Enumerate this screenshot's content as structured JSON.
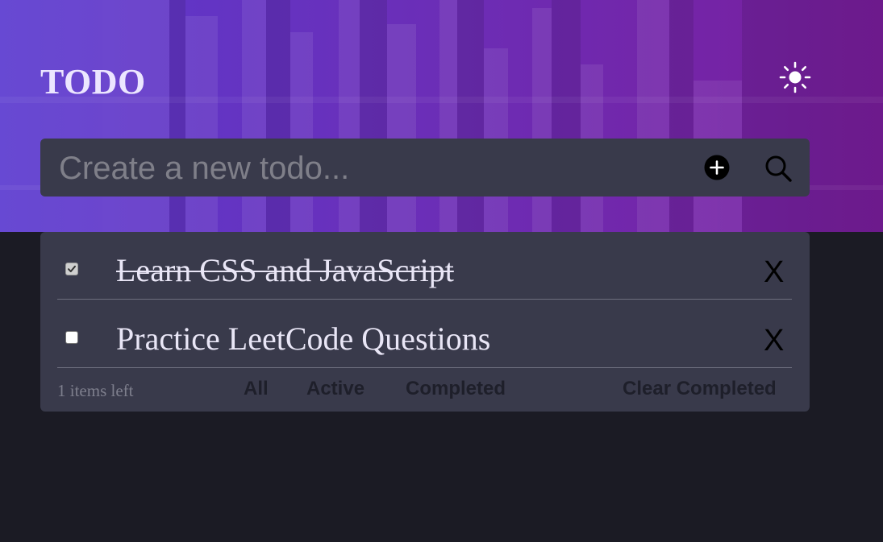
{
  "app": {
    "title": "TODO",
    "theme_icon": "sun-icon"
  },
  "input": {
    "placeholder": "Create a new todo...",
    "value": "",
    "add_icon": "add-circle-icon",
    "search_icon": "search-icon"
  },
  "todos": [
    {
      "text": "Learn CSS and JavaScript",
      "completed": true,
      "delete_label": "X"
    },
    {
      "text": "Practice LeetCode Questions",
      "completed": false,
      "delete_label": "X"
    }
  ],
  "footer": {
    "items_left": "1 items left",
    "filters": [
      "All",
      "Active",
      "Completed"
    ],
    "clear_label": "Clear Completed"
  },
  "colors": {
    "page_background": "#1b1b24",
    "card_background": "#393a4b",
    "gradient_start": "#5b3ad0",
    "gradient_end": "#7a1e9c",
    "text_primary": "#e9e6f6",
    "text_muted": "#7e7f8d"
  }
}
